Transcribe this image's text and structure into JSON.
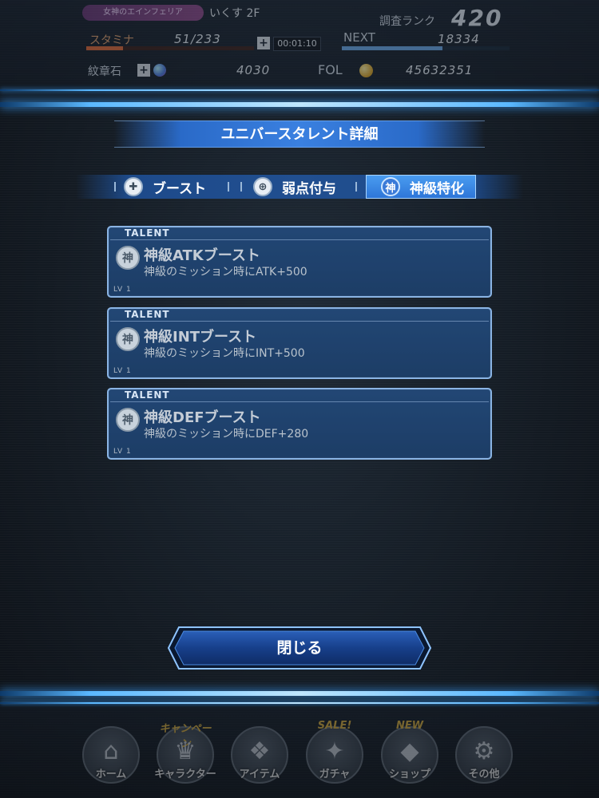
{
  "status": {
    "title_pill": "女神のエインフェリア",
    "floor": "いくす 2F",
    "rank_label": "調査ランク",
    "rank_value": "420",
    "stamina_label": "スタミナ",
    "stamina_value": "51/233",
    "stamina_fraction": 0.22,
    "timer": "00:01:10",
    "next_label": "NEXT",
    "next_value": "18334",
    "next_fraction": 0.6,
    "medal_label": "紋章石",
    "medal_value": "4030",
    "fol_label": "FOL",
    "fol_value": "45632351"
  },
  "dialog": {
    "title": "ユニバースタレント詳細",
    "tabs": [
      {
        "label": "ブースト",
        "icon": "cross-icon",
        "glyph": "✚",
        "active": false
      },
      {
        "label": "弱点付与",
        "icon": "crosshair-icon",
        "glyph": "⊕",
        "active": false
      },
      {
        "label": "神級特化",
        "icon": "god-kanji-icon",
        "glyph": "神",
        "active": true
      }
    ],
    "talents": [
      {
        "tag": "TALENT",
        "icon_glyph": "神",
        "name": "神級ATKブースト",
        "desc": "神級のミッション時にATK+500",
        "lv": "LV 1"
      },
      {
        "tag": "TALENT",
        "icon_glyph": "神",
        "name": "神級INTブースト",
        "desc": "神級のミッション時にINT+500",
        "lv": "LV 1"
      },
      {
        "tag": "TALENT",
        "icon_glyph": "神",
        "name": "神級DEFブースト",
        "desc": "神級のミッション時にDEF+280",
        "lv": "LV 1"
      }
    ],
    "close_label": "閉じる"
  },
  "nav": {
    "items": [
      {
        "label": "ホーム",
        "glyph": "⌂",
        "badge": ""
      },
      {
        "label": "キャラクター",
        "glyph": "♛",
        "badge": "キャンペーン"
      },
      {
        "label": "アイテム",
        "glyph": "❖",
        "badge": ""
      },
      {
        "label": "ガチャ",
        "glyph": "✦",
        "badge": "SALE!"
      },
      {
        "label": "ショップ",
        "glyph": "◆",
        "badge": "NEW"
      },
      {
        "label": "その他",
        "glyph": "⚙",
        "badge": ""
      }
    ]
  },
  "colors": {
    "accent_blue": "#3a80e0",
    "frame_glow": "#5ab8ff",
    "card_bg": "#2b5a94"
  }
}
